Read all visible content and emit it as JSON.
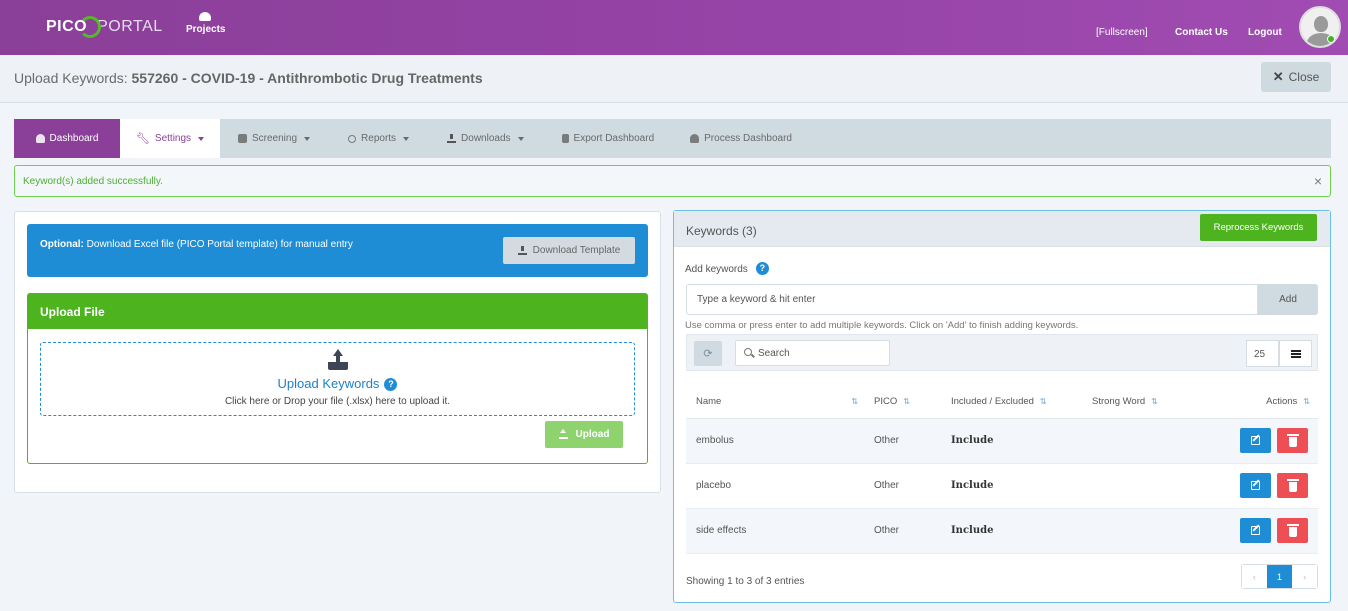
{
  "header": {
    "logo_left": "PICO",
    "logo_right": "PORTAL",
    "projects_label": "Projects",
    "fullscreen_label": "[Fullscreen]",
    "contact_label": "Contact Us",
    "logout_label": "Logout",
    "online_status_color": "#3cb521"
  },
  "page": {
    "title_prefix": "Upload Keywords: ",
    "title_main": "557260 - COVID-19 - Antithrombotic Drug Treatments",
    "close_label": "Close"
  },
  "tabs": [
    {
      "label": "Dashboard",
      "icon": "dashboard-icon",
      "state": "active"
    },
    {
      "label": "Settings",
      "icon": "wrench-icon",
      "state": "open",
      "dropdown": true
    },
    {
      "label": "Screening",
      "icon": "clipboard-check-icon",
      "dropdown": true
    },
    {
      "label": "Reports",
      "icon": "search-icon",
      "dropdown": true
    },
    {
      "label": "Downloads",
      "icon": "download-icon",
      "dropdown": true
    },
    {
      "label": "Export Dashboard",
      "icon": "clipboard-icon"
    },
    {
      "label": "Process Dashboard",
      "icon": "dashboard-icon"
    }
  ],
  "alert": {
    "message": "Keyword(s) added successfully.",
    "close": "×"
  },
  "template_box": {
    "bold": "Optional:",
    "text": " Download Excel file (PICO Portal template) for manual entry",
    "button_label": "Download Template"
  },
  "upload": {
    "header": "Upload File",
    "title": "Upload Keywords",
    "help": "?",
    "subtitle": "Click here or Drop your file (.xlsx) here to upload it.",
    "button_label": "Upload"
  },
  "keywords": {
    "title": "Keywords (3)",
    "reprocess_label": "Reprocess Keywords",
    "add_label": "Add keywords",
    "help": "?",
    "input_placeholder": "Type a keyword & hit enter",
    "input_value": "",
    "add_button": "Add",
    "hint": "Use comma or press enter to add multiple keywords. Click on 'Add' to finish adding keywords.",
    "search_placeholder": "Search",
    "page_size": "25",
    "columns": [
      "Name",
      "PICO",
      "Included / Excluded",
      "Strong Word",
      "Actions"
    ],
    "rows": [
      {
        "name": "embolus",
        "pico": "Other",
        "status": "Include",
        "strong": ""
      },
      {
        "name": "placebo",
        "pico": "Other",
        "status": "Include",
        "strong": ""
      },
      {
        "name": "side effects",
        "pico": "Other",
        "status": "Include",
        "strong": ""
      }
    ],
    "showing": "Showing 1 to 3 of 3 entries",
    "pagination": {
      "prev": "‹",
      "current": "1",
      "next": "›"
    }
  },
  "colors": {
    "brand_purple": "#8a3f98",
    "primary_blue": "#1f8dd6",
    "success_green": "#4db420",
    "danger_red": "#ed4f55"
  }
}
